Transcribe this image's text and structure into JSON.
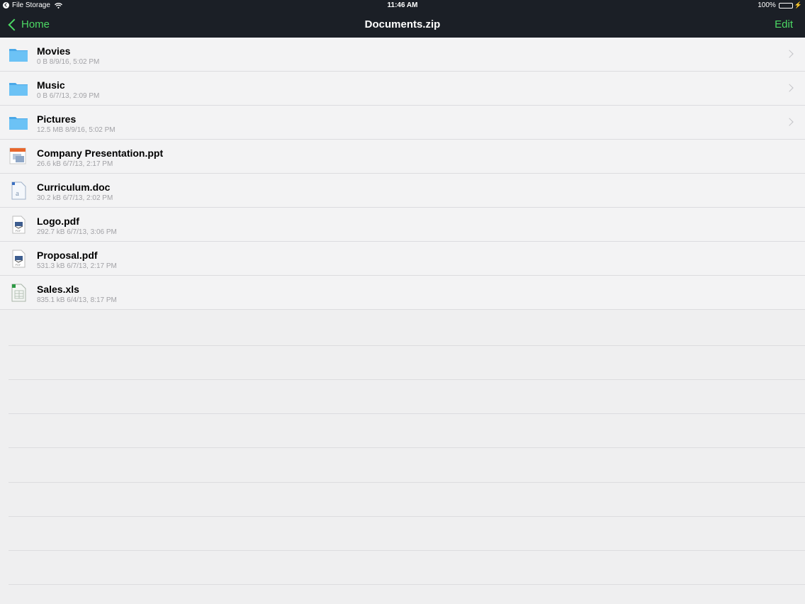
{
  "status_bar": {
    "carrier": "File Storage",
    "time": "11:46 AM",
    "battery": "100%"
  },
  "nav": {
    "back_label": "Home",
    "title": "Documents.zip",
    "edit_label": "Edit"
  },
  "colors": {
    "accent": "#4cd964",
    "nav_bg": "#1b1f26",
    "folder": "#5ab7f0"
  },
  "files": [
    {
      "name": "Movies",
      "meta": "0 B 8/9/16, 5:02 PM",
      "icon": "folder-icon",
      "has_chevron": true
    },
    {
      "name": "Music",
      "meta": "0 B 6/7/13, 2:09 PM",
      "icon": "folder-icon",
      "has_chevron": true
    },
    {
      "name": "Pictures",
      "meta": "12.5 MB 8/9/16, 5:02 PM",
      "icon": "folder-icon",
      "has_chevron": true
    },
    {
      "name": "Company Presentation.ppt",
      "meta": "26.6 kB 6/7/13, 2:17 PM",
      "icon": "ppt-file-icon",
      "has_chevron": false
    },
    {
      "name": "Curriculum.doc",
      "meta": "30.2 kB 6/7/13, 2:02 PM",
      "icon": "doc-file-icon",
      "has_chevron": false
    },
    {
      "name": "Logo.pdf",
      "meta": "292.7 kB 6/7/13, 3:06 PM",
      "icon": "pdf-file-icon",
      "has_chevron": false
    },
    {
      "name": "Proposal.pdf",
      "meta": "531.3 kB 6/7/13, 2:17 PM",
      "icon": "pdf-file-icon",
      "has_chevron": false
    },
    {
      "name": "Sales.xls",
      "meta": "835.1 kB 6/4/13, 8:17 PM",
      "icon": "xls-file-icon",
      "has_chevron": false
    }
  ]
}
